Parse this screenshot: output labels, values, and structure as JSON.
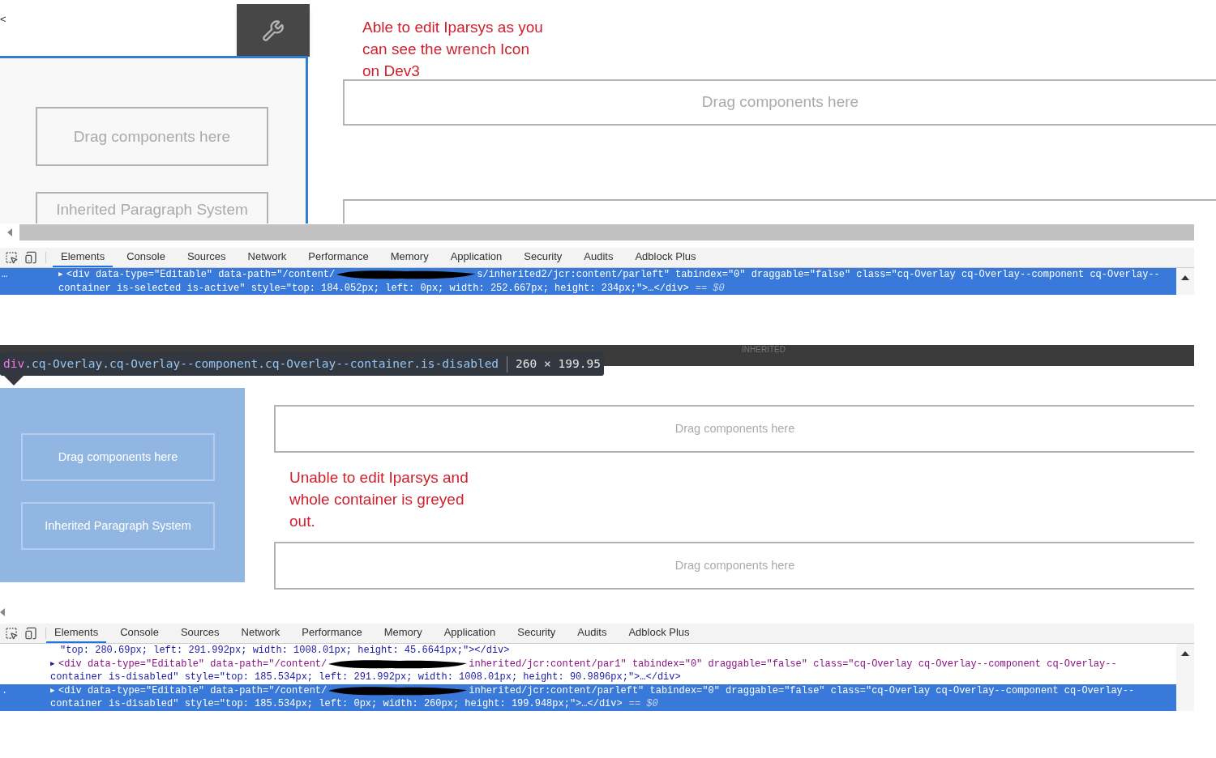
{
  "top_capture": {
    "back_glyph": "<",
    "left_container": {
      "selected": true,
      "disabled": false,
      "placeholders": [
        "Drag components here",
        "Inherited Paragraph System"
      ]
    },
    "annotation_lines": [
      "Able to edit Iparsys as you",
      "can see the wrench Icon",
      "on Dev3"
    ],
    "right_placeholders": [
      "Drag components here"
    ],
    "devtools": {
      "tabs": [
        {
          "label": "Elements",
          "selected": true
        },
        {
          "label": "Console",
          "selected": false
        },
        {
          "label": "Sources",
          "selected": false
        },
        {
          "label": "Network",
          "selected": false
        },
        {
          "label": "Performance",
          "selected": false
        },
        {
          "label": "Memory",
          "selected": false
        },
        {
          "label": "Application",
          "selected": false
        },
        {
          "label": "Security",
          "selected": false
        },
        {
          "label": "Audits",
          "selected": false
        },
        {
          "label": "Adblock Plus",
          "selected": false
        }
      ],
      "code": [
        {
          "selected": true,
          "gutter": "…",
          "marker": "▶",
          "head": "<div data-type=\"Editable\" data-path=\"/content/",
          "redacted": true,
          "tail": "s/inherited2/jcr:content/parleft\" tabindex=\"0\" draggable=\"false\" class=\"cq-Overlay cq-Overlay--component cq-Overlay--",
          "continuation": "container is-selected is-active\" style=\"top: 184.052px; left: 0px; width: 252.667px; height: 234px;\">…</div>",
          "suffix": "== $0"
        }
      ]
    }
  },
  "bottom_capture": {
    "toolbar_label": "INHERITED",
    "tooltip": {
      "tag": "div",
      "classes": ".cq-Overlay.cq-Overlay--component.cq-Overlay--container.is-disabled",
      "size": "260 × 199.95"
    },
    "left_container": {
      "selected": false,
      "disabled": true,
      "placeholders": [
        "Drag components here",
        "Inherited Paragraph System"
      ]
    },
    "right_placeholders": [
      "Drag components here",
      "Drag components here"
    ],
    "annotation_lines": [
      "Unable to edit Iparsys and",
      "whole container is greyed",
      "out."
    ],
    "devtools": {
      "tabs": [
        {
          "label": "Elements",
          "selected": true
        },
        {
          "label": "Console",
          "selected": false
        },
        {
          "label": "Sources",
          "selected": false
        },
        {
          "label": "Network",
          "selected": false
        },
        {
          "label": "Performance",
          "selected": false
        },
        {
          "label": "Memory",
          "selected": false
        },
        {
          "label": "Application",
          "selected": false
        },
        {
          "label": "Security",
          "selected": false
        },
        {
          "label": "Audits",
          "selected": false
        },
        {
          "label": "Adblock Plus",
          "selected": false
        }
      ],
      "code": [
        {
          "selected": false,
          "continuation": "\"top: 280.69px; left: 291.992px; width: 1008.01px; height: 45.6641px;\"></div>"
        },
        {
          "selected": false,
          "marker": "▶",
          "head": "<div data-type=\"Editable\" data-path=\"/content/",
          "redacted": true,
          "tail": "inherited/jcr:content/par1\" tabindex=\"0\" draggable=\"false\" class=\"cq-Overlay cq-Overlay--component cq-Overlay--",
          "continuation": "container is-disabled\" style=\"top: 185.534px; left: 291.992px; width: 1008.01px; height: 90.9896px;\">…</div>"
        },
        {
          "selected": true,
          "gutter": ".",
          "marker": "▶",
          "head": "<div data-type=\"Editable\" data-path=\"/content/",
          "redacted": true,
          "tail": "inherited/jcr:content/parleft\" tabindex=\"0\" draggable=\"false\" class=\"cq-Overlay cq-Overlay--component cq-Overlay--",
          "continuation": "container is-disabled\" style=\"top: 185.534px; left: 0px; width: 260px; height: 199.948px;\">…</div>",
          "suffix": "== $0"
        }
      ]
    }
  }
}
